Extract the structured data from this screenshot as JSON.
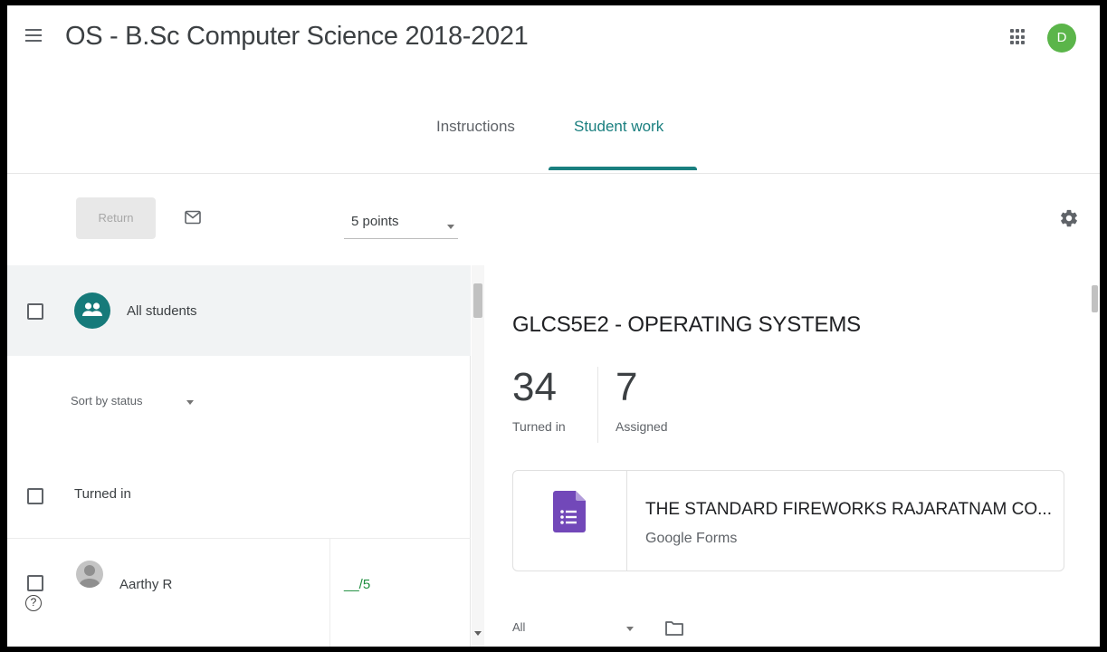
{
  "header": {
    "title": "OS - B.Sc Computer Science 2018-2021",
    "menu_icon": "hamburger-menu-icon",
    "apps_icon": "google-apps-grid-icon",
    "avatar_initial": "D",
    "avatar_color": "#5bb54a"
  },
  "tabs": [
    {
      "label": "Instructions",
      "active": false
    },
    {
      "label": "Student work",
      "active": true
    }
  ],
  "accent_color": "#1a7f7f",
  "toolbar": {
    "return_label": "Return",
    "mail_icon": "envelope-icon",
    "points_value": "5 points",
    "settings_icon": "gear-icon"
  },
  "left_panel": {
    "all_students_label": "All students",
    "sort_value": "Sort by status",
    "section_label": "Turned in",
    "students": [
      {
        "name": "Aarthy R",
        "score": "__/5"
      }
    ],
    "help_icon": "?"
  },
  "right_panel": {
    "assignment_title": "GLCS5E2 - OPERATING SYSTEMS",
    "stats": {
      "turned_in_count": "34",
      "turned_in_label": "Turned in",
      "assigned_count": "7",
      "assigned_label": "Assigned"
    },
    "attachment": {
      "title": "THE STANDARD FIREWORKS RAJARATNAM CO...",
      "subtitle": "Google Forms",
      "icon": "google-forms-icon",
      "icon_color": "#7248b9"
    },
    "filter_value": "All",
    "folder_icon": "folder-icon"
  }
}
